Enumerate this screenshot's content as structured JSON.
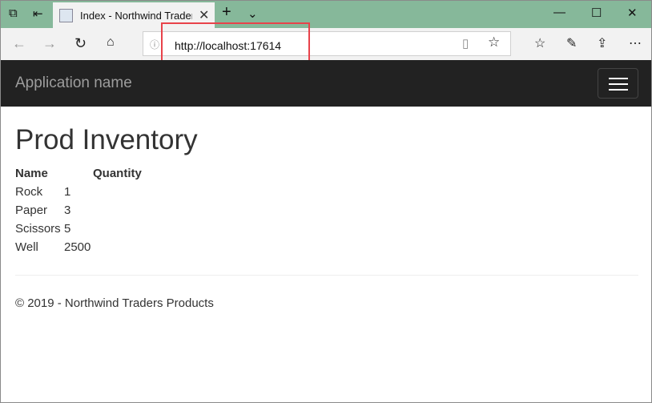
{
  "browser": {
    "tab_title": "Index - Northwind Traders Products",
    "url": "http://localhost:17614"
  },
  "app": {
    "brand": "Application name"
  },
  "page": {
    "title": "Prod Inventory",
    "columns": [
      "Name",
      "Quantity"
    ],
    "rows": [
      {
        "name": "Rock",
        "qty": "1"
      },
      {
        "name": "Paper",
        "qty": "3"
      },
      {
        "name": "Scissors",
        "qty": "5"
      },
      {
        "name": "Well",
        "qty": "2500"
      }
    ]
  },
  "footer": "© 2019 - Northwind Traders Products",
  "colors": {
    "highlight": "#e8424a",
    "navbar": "#222222",
    "titlebar": "#86b89a"
  }
}
